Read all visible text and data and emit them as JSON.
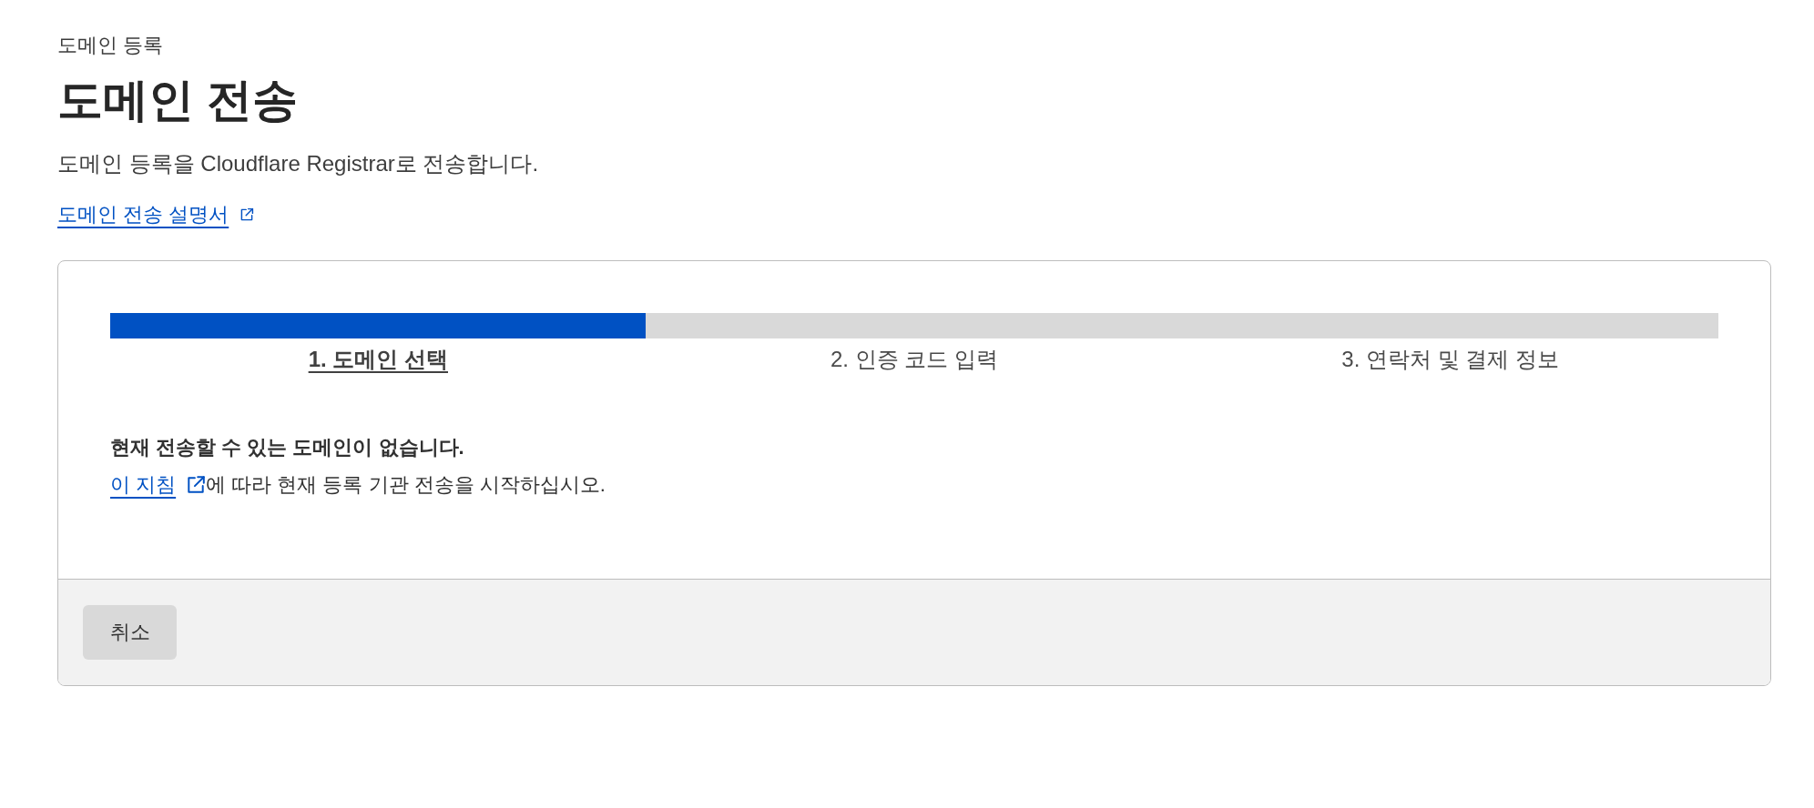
{
  "breadcrumb": "도메인 등록",
  "title": "도메인 전송",
  "description": "도메인 등록을 Cloudflare Registrar로 전송합니다.",
  "guide_link": {
    "label": "도메인 전송 설명서"
  },
  "transfer_card": {
    "progress": {
      "level": 0.333
    },
    "steps": [
      {
        "label": "1. 도메인 선택",
        "selected": true
      },
      {
        "label": "2. 인증 코드 입력",
        "selected": false
      },
      {
        "label": "3. 연락처 및 결제 정보",
        "selected": false
      }
    ],
    "message": {
      "heading": "현재 전송할 수 있는 도메인이 없습니다.",
      "link": "이 지침",
      "text": "에 따라 현재 등록 기관 전송을 시작하십시오."
    },
    "buttons": [
      {
        "label": "취소"
      }
    ]
  }
}
